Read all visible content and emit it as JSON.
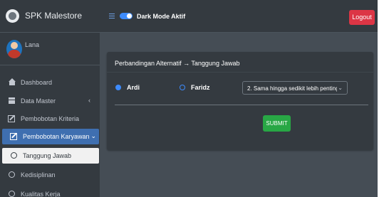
{
  "sidebar": {
    "brand": "SPK Malestore",
    "user_name": "Lana",
    "items": {
      "dashboard": "Dashboard",
      "data_master": "Data Master",
      "pembobotan_kriteria": "Pembobotan Kriteria",
      "pembobotan_karyawan": "Pembobotan Karyawan",
      "tanggung_jawab": "Tanggung Jawab",
      "kedisiplinan": "Kedisiplinan",
      "kualitas_kerja": "Kualitas Kerja"
    }
  },
  "topbar": {
    "dark_mode_label": "Dark Mode Aktif",
    "dark_mode_on": true,
    "logout_label": "Logout"
  },
  "card": {
    "title": "Perbandingan Alternatif → Tanggung Jawab",
    "alternative_a": "Ardi",
    "alternative_b": "Faridz",
    "comparison_value": "2. Sama hingga sedikit lebih penting",
    "submit_label": "SUBMIT"
  },
  "colors": {
    "sidebar_bg": "#343a40",
    "content_bg": "#454d55",
    "active_item": "#3f6fb0",
    "logout": "#dc3545",
    "submit": "#28a745",
    "accent": "#3d8bfd"
  }
}
